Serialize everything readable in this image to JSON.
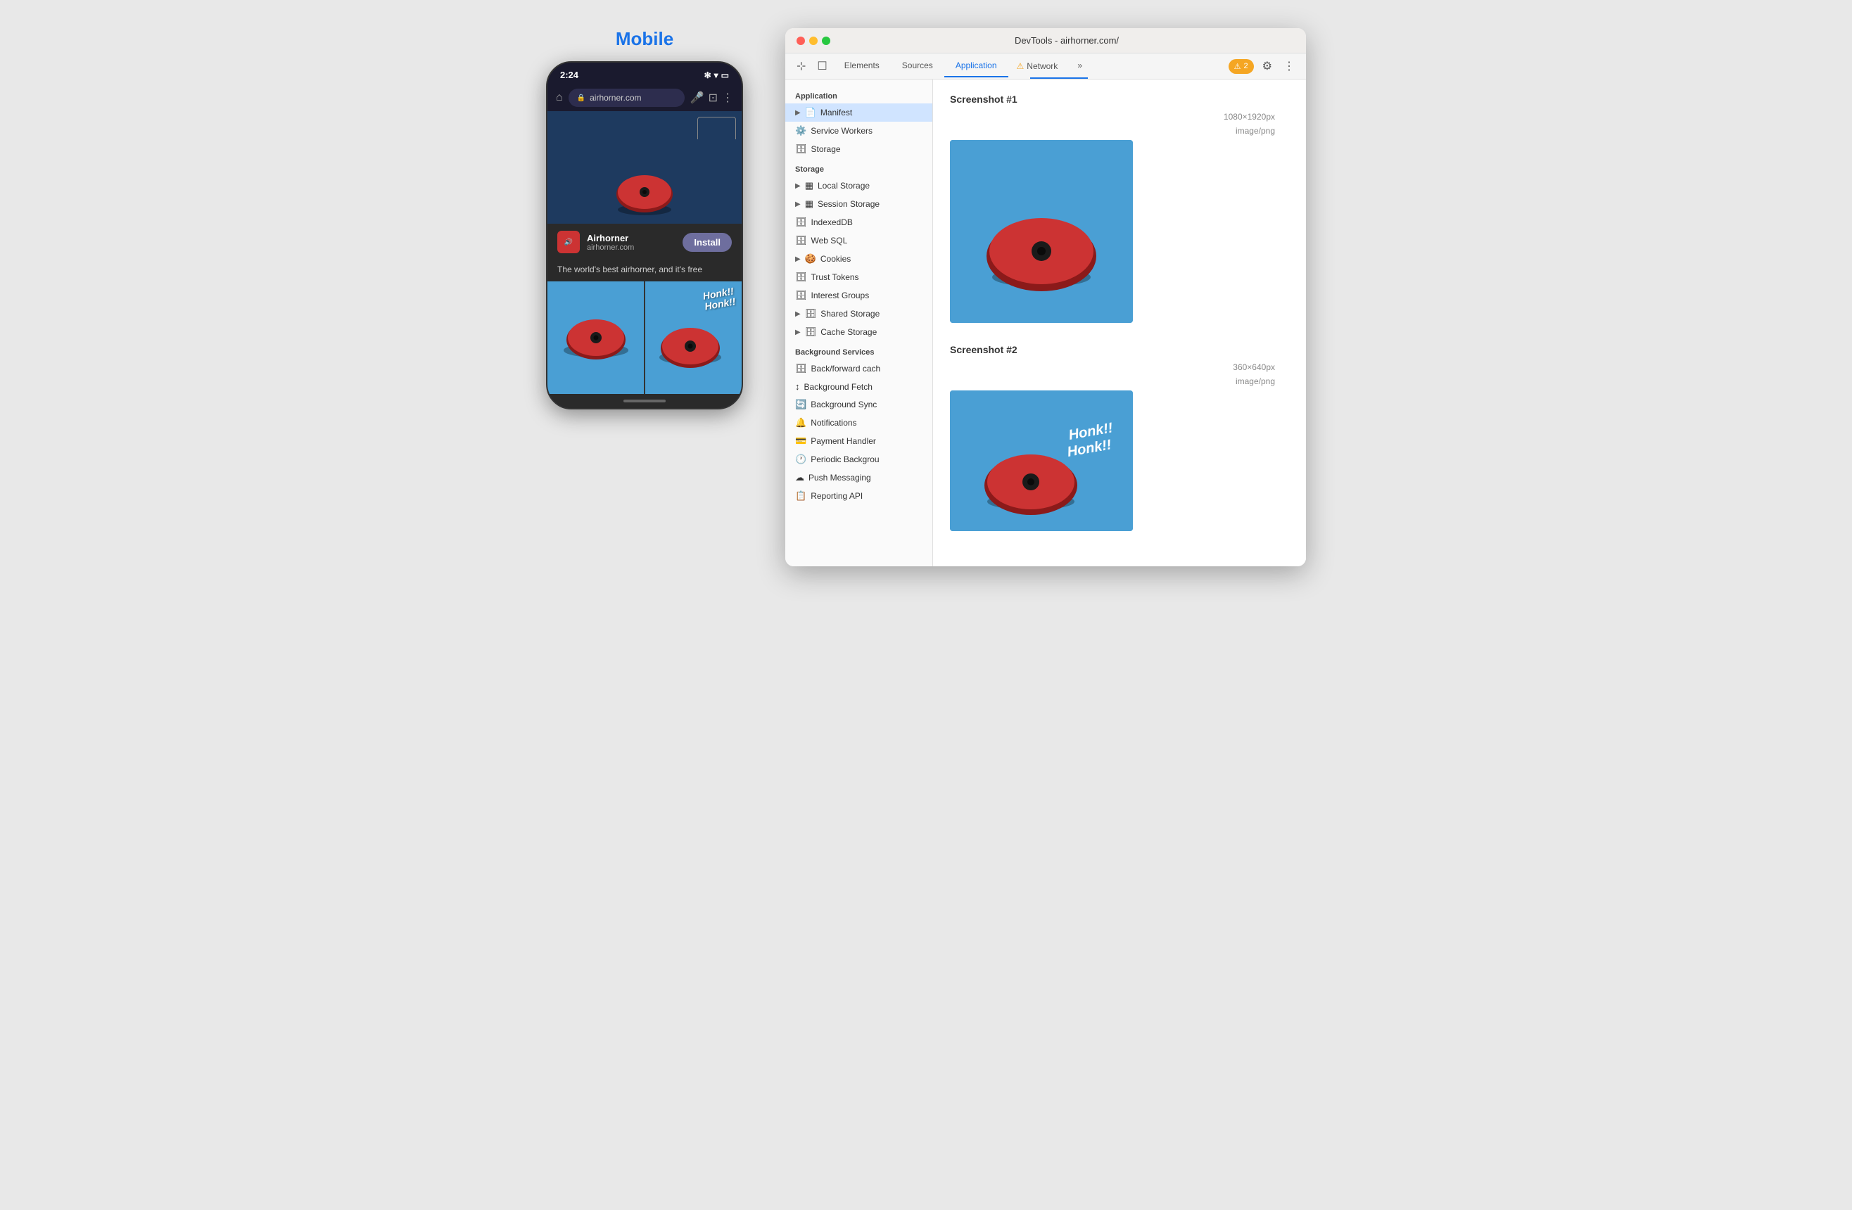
{
  "mobile": {
    "label": "Mobile",
    "status_time": "2:24",
    "address": "airhorner.com",
    "install_btn_top": "Install",
    "app_name": "Airhorner",
    "app_domain": "airhorner.com",
    "install_btn": "Install",
    "tagline": "The world's best airhorner, and it's free",
    "honk_text_1": "Honk!!\nHonk!!"
  },
  "devtools": {
    "title": "DevTools - airhorner.com/",
    "tabs": [
      {
        "label": "Elements",
        "active": false
      },
      {
        "label": "Sources",
        "active": false
      },
      {
        "label": "Application",
        "active": true
      },
      {
        "label": "Network",
        "active": false
      }
    ],
    "warning_count": "2",
    "sidebar": {
      "sections": [
        {
          "label": "Application",
          "items": [
            {
              "label": "Manifest",
              "icon": "📄",
              "has_arrow": true,
              "active": true
            },
            {
              "label": "Service Workers",
              "icon": "⚙️",
              "has_arrow": false
            },
            {
              "label": "Storage",
              "icon": "🗄️",
              "has_arrow": false
            }
          ]
        },
        {
          "label": "Storage",
          "items": [
            {
              "label": "Local Storage",
              "icon": "▦",
              "has_arrow": true
            },
            {
              "label": "Session Storage",
              "icon": "▦",
              "has_arrow": true
            },
            {
              "label": "IndexedDB",
              "icon": "🗄️",
              "has_arrow": false
            },
            {
              "label": "Web SQL",
              "icon": "🗄️",
              "has_arrow": false
            },
            {
              "label": "Cookies",
              "icon": "🍪",
              "has_arrow": true
            },
            {
              "label": "Trust Tokens",
              "icon": "🗄️",
              "has_arrow": false
            },
            {
              "label": "Interest Groups",
              "icon": "🗄️",
              "has_arrow": false
            },
            {
              "label": "Shared Storage",
              "icon": "🗄️",
              "has_arrow": true
            },
            {
              "label": "Cache Storage",
              "icon": "🗄️",
              "has_arrow": true
            }
          ]
        },
        {
          "label": "Background Services",
          "items": [
            {
              "label": "Back/forward cach",
              "icon": "🗄️"
            },
            {
              "label": "Background Fetch",
              "icon": "↕"
            },
            {
              "label": "Background Sync",
              "icon": "🔄"
            },
            {
              "label": "Notifications",
              "icon": "🔔"
            },
            {
              "label": "Payment Handler",
              "icon": "💳"
            },
            {
              "label": "Periodic Backgrou",
              "icon": "🕐"
            },
            {
              "label": "Push Messaging",
              "icon": "☁️"
            },
            {
              "label": "Reporting API",
              "icon": "📋"
            }
          ]
        }
      ]
    },
    "screenshots": [
      {
        "title": "Screenshot #1",
        "dimensions": "1080×1920px",
        "type": "image/png"
      },
      {
        "title": "Screenshot #2",
        "dimensions": "360×640px",
        "type": "image/png"
      }
    ]
  }
}
